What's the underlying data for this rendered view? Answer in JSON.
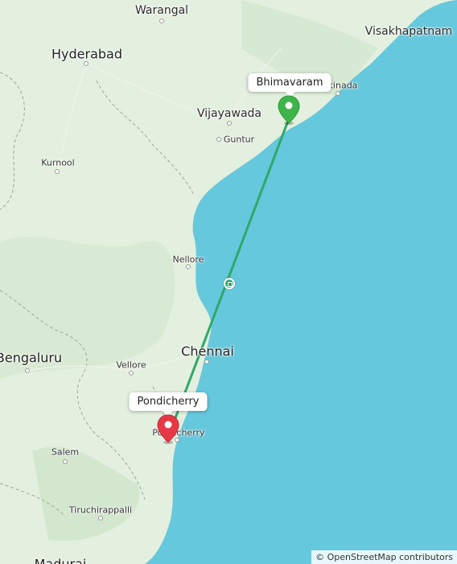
{
  "map": {
    "cities": [
      {
        "name": "Warangal",
        "size": "mid"
      },
      {
        "name": "Hyderabad",
        "size": "big"
      },
      {
        "name": "Visakhapatnam",
        "size": "mid"
      },
      {
        "name": "kinada",
        "size": "small"
      },
      {
        "name": "Vijayawada",
        "size": "mid"
      },
      {
        "name": "Guntur",
        "size": "small"
      },
      {
        "name": "Kurnool",
        "size": "small"
      },
      {
        "name": "Nellore",
        "size": "small"
      },
      {
        "name": "Bengaluru",
        "size": "big"
      },
      {
        "name": "Vellore",
        "size": "small"
      },
      {
        "name": "Chennai",
        "size": "big"
      },
      {
        "name": "Pondicherry",
        "size": "small"
      },
      {
        "name": "Salem",
        "size": "small"
      },
      {
        "name": "Tiruchirappalli",
        "size": "small"
      },
      {
        "name": "Madurai",
        "size": "big"
      }
    ],
    "route": {
      "origin": {
        "label": "Bhimavaram",
        "color": "#3db54a"
      },
      "destination": {
        "label": "Pondicherry",
        "color": "#e53946"
      },
      "line_color": "#2fa86a",
      "midpoint_icon": "train-icon"
    },
    "colors": {
      "land": "#dfeedc",
      "sea": "#66c8dc",
      "border": "#9aa99a"
    },
    "attribution": "© OpenStreetMap contributors"
  }
}
